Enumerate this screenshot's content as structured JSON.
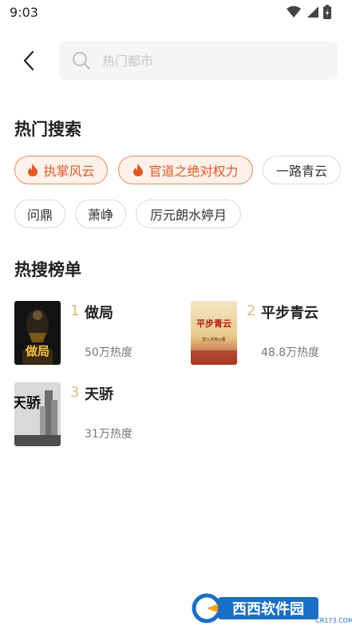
{
  "status_bar": {
    "time": "9:03"
  },
  "search": {
    "placeholder": "热门都市",
    "value": ""
  },
  "hot_search": {
    "title": "热门搜索",
    "chips": [
      {
        "label": "执掌风云",
        "hot": true
      },
      {
        "label": "官道之绝对权力",
        "hot": true
      },
      {
        "label": "一路青云",
        "hot": false
      },
      {
        "label": "问鼎",
        "hot": false
      },
      {
        "label": "萧峥",
        "hot": false
      },
      {
        "label": "厉元朗水婷月",
        "hot": false
      }
    ]
  },
  "ranking": {
    "title": "热搜榜单",
    "items": [
      {
        "rank": "1",
        "title": "做局",
        "heat": "50万热度",
        "cover_text": "做局"
      },
      {
        "rank": "2",
        "title": "平步青云",
        "heat": "48.8万热度",
        "cover_text": "平步青云",
        "cover_sub": "梦入洪荒◎著"
      },
      {
        "rank": "3",
        "title": "天骄",
        "heat": "31万热度",
        "cover_text": "天骄"
      }
    ]
  },
  "watermark": {
    "text": "西西软件园",
    "sub": "CR173.COM"
  },
  "colors": {
    "accent": "#e15a24",
    "rank": "#e1b887",
    "chip_hot_bg": "#fdf1ea"
  }
}
